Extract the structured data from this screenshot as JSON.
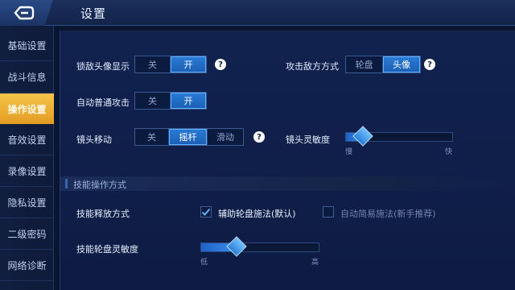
{
  "header": {
    "title": "设置",
    "back_icon": "back-arrow-icon"
  },
  "sidebar": {
    "items": [
      {
        "label": "基础设置",
        "active": false
      },
      {
        "label": "战斗信息",
        "active": false
      },
      {
        "label": "操作设置",
        "active": true
      },
      {
        "label": "音效设置",
        "active": false
      },
      {
        "label": "录像设置",
        "active": false
      },
      {
        "label": "隐私设置",
        "active": false
      },
      {
        "label": "二级密码",
        "active": false
      },
      {
        "label": "网络诊断",
        "active": false
      }
    ]
  },
  "settings": {
    "lock_avatar": {
      "label": "锁敌头像显示",
      "options": [
        "关",
        "开"
      ],
      "selected": "开",
      "help": "?"
    },
    "attack_enemy": {
      "label": "攻击敌方方式",
      "options": [
        "轮盘",
        "头像"
      ],
      "selected": "头像",
      "help": "?"
    },
    "auto_attack": {
      "label": "自动普通攻击",
      "options": [
        "关",
        "开"
      ],
      "selected": "开"
    },
    "camera_move": {
      "label": "镜头移动",
      "options": [
        "关",
        "摇杆",
        "滑动"
      ],
      "selected": "摇杆",
      "help": "?"
    },
    "camera_sensitivity": {
      "label": "镜头灵敏度",
      "min_label": "慢",
      "max_label": "快",
      "value": 0.16
    }
  },
  "skill_section": {
    "title": "技能操作方式",
    "cast_mode": {
      "label": "技能释放方式",
      "option1": {
        "label": "辅助轮盘施法(默认)",
        "checked": true
      },
      "option2": {
        "label": "自动简易施法(新手推荐)",
        "checked": false
      }
    },
    "wheel_sensitivity": {
      "label": "技能轮盘灵敏度",
      "min_label": "低",
      "max_label": "高",
      "value": 0.3
    }
  },
  "colors": {
    "accent": "#2a7bd6",
    "active_tab": "#f0b83a",
    "background": "#0e1c43"
  }
}
